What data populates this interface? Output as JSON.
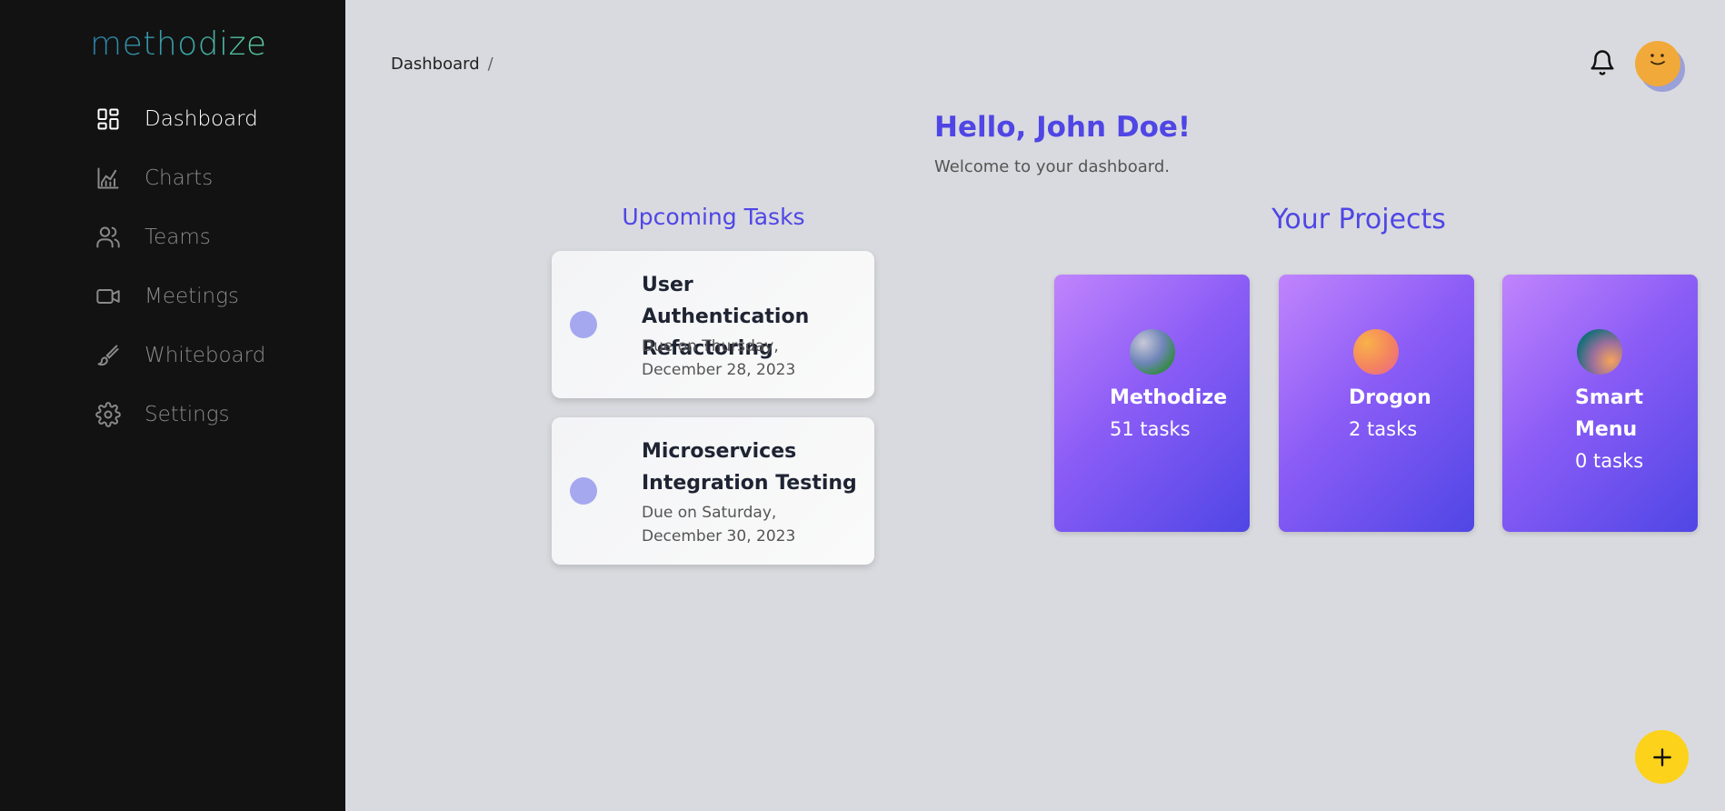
{
  "app": {
    "logo": "methodize"
  },
  "sidebar": {
    "items": [
      {
        "label": "Dashboard",
        "icon": "dashboard-icon",
        "active": true
      },
      {
        "label": "Charts",
        "icon": "chart-icon"
      },
      {
        "label": "Teams",
        "icon": "users-icon"
      },
      {
        "label": "Meetings",
        "icon": "video-icon"
      },
      {
        "label": "Whiteboard",
        "icon": "brush-icon"
      },
      {
        "label": "Settings",
        "icon": "gear-icon"
      }
    ]
  },
  "header": {
    "breadcrumb": "Dashboard",
    "breadcrumb_sep": "/",
    "bell_icon": "bell-icon",
    "avatar_icon": "avatar-face-icon"
  },
  "main": {
    "greeting": "Hello, John Doe!",
    "welcome": "Welcome to your dashboard."
  },
  "tasks": {
    "title": "Upcoming Tasks",
    "items": [
      {
        "name": "User Authentication Refactoring",
        "due": "Due on Thursday, December 28, 2023"
      },
      {
        "name": "Microservices Integration Testing",
        "due": "Due on Saturday, December 30, 2023"
      }
    ]
  },
  "projects": {
    "title": "Your Projects",
    "items": [
      {
        "name": "Methodize",
        "count": "51 tasks"
      },
      {
        "name": "Drogon",
        "count": "2 tasks"
      },
      {
        "name": "Smart Menu",
        "count": "0 tasks"
      }
    ]
  },
  "colors": {
    "accent": "#4f46e5",
    "sidebar_bg": "#121212",
    "fab": "#fcd21a",
    "avatar": "#f1a93a"
  },
  "fab": {
    "icon": "plus-icon"
  }
}
